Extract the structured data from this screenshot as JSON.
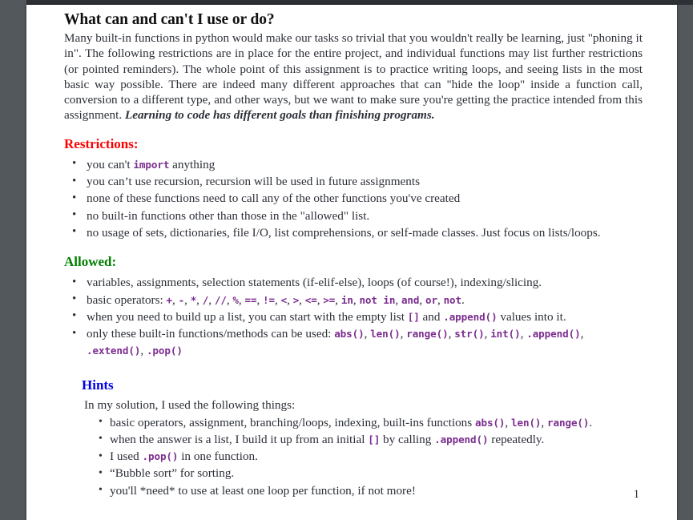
{
  "document": {
    "title": "What can and can't I use or do?",
    "intro_before_emphasis": "Many built-in functions in python would make our tasks so trivial that you wouldn't really be learning, just \"phoning it in\". The following restrictions are in place for the entire project, and individual functions may list further restrictions (or pointed reminders). The whole point of this assignment is to practice writing loops, and seeing lists in the most basic way possible. There are indeed many different approaches that can \"hide the loop\" inside a function call, conversion to a different type, and other ways, but we want to make sure you're getting the practice intended from this assignment. ",
    "intro_emphasis": "Learning to code has different goals than finishing programs.",
    "page_number": "1"
  },
  "restrictions": {
    "heading": "Restrictions:",
    "heading_color": "#ff0000",
    "items": [
      {
        "parts": [
          {
            "text": "you can't ",
            "style": "normal"
          },
          {
            "text": "import",
            "style": "code"
          },
          {
            "text": " anything",
            "style": "normal"
          }
        ]
      },
      {
        "parts": [
          {
            "text": "you can’t use recursion, recursion will be used in future assignments",
            "style": "normal"
          }
        ]
      },
      {
        "parts": [
          {
            "text": "none of these functions need to call any of the other functions you've created",
            "style": "normal"
          }
        ]
      },
      {
        "parts": [
          {
            "text": "no built-in functions other than those in the \"allowed\" list.",
            "style": "normal"
          }
        ]
      },
      {
        "parts": [
          {
            "text": "no usage of sets, dictionaries, file I/O, list comprehensions, or self-made classes. Just focus on lists/loops.",
            "style": "normal"
          }
        ]
      }
    ]
  },
  "allowed": {
    "heading": "Allowed:",
    "heading_color": "#008000",
    "items": [
      {
        "parts": [
          {
            "text": "variables, assignments, selection statements (if-elif-else), loops (of course!), indexing/slicing.",
            "style": "normal"
          }
        ]
      },
      {
        "parts": [
          {
            "text": "basic operators: ",
            "style": "normal"
          },
          {
            "text": "+",
            "style": "code"
          },
          {
            "text": ", ",
            "style": "normal"
          },
          {
            "text": "-",
            "style": "code"
          },
          {
            "text": ", ",
            "style": "normal"
          },
          {
            "text": "*",
            "style": "code"
          },
          {
            "text": ", ",
            "style": "normal"
          },
          {
            "text": "/",
            "style": "code"
          },
          {
            "text": ", ",
            "style": "normal"
          },
          {
            "text": "//",
            "style": "code"
          },
          {
            "text": ", ",
            "style": "normal"
          },
          {
            "text": "%",
            "style": "code"
          },
          {
            "text": ", ",
            "style": "normal"
          },
          {
            "text": "==",
            "style": "code"
          },
          {
            "text": ", ",
            "style": "normal"
          },
          {
            "text": "!=",
            "style": "code"
          },
          {
            "text": ", ",
            "style": "normal"
          },
          {
            "text": "<",
            "style": "code"
          },
          {
            "text": ", ",
            "style": "normal"
          },
          {
            "text": ">",
            "style": "code"
          },
          {
            "text": ", ",
            "style": "normal"
          },
          {
            "text": "<=",
            "style": "code"
          },
          {
            "text": ", ",
            "style": "normal"
          },
          {
            "text": ">=",
            "style": "code"
          },
          {
            "text": ", ",
            "style": "normal"
          },
          {
            "text": "in",
            "style": "code"
          },
          {
            "text": ", ",
            "style": "normal"
          },
          {
            "text": "not  in",
            "style": "code"
          },
          {
            "text": ", ",
            "style": "normal"
          },
          {
            "text": "and",
            "style": "code"
          },
          {
            "text": ", ",
            "style": "normal"
          },
          {
            "text": "or",
            "style": "code"
          },
          {
            "text": ", ",
            "style": "normal"
          },
          {
            "text": "not",
            "style": "code"
          },
          {
            "text": ".",
            "style": "normal"
          }
        ]
      },
      {
        "parts": [
          {
            "text": "when you need to build up a list, you can start with the empty list ",
            "style": "normal"
          },
          {
            "text": "[]",
            "style": "code"
          },
          {
            "text": " and ",
            "style": "normal"
          },
          {
            "text": ".append()",
            "style": "code"
          },
          {
            "text": " values into it.",
            "style": "normal"
          }
        ]
      },
      {
        "parts": [
          {
            "text": "only these built-in functions/methods can be used: ",
            "style": "normal"
          },
          {
            "text": "abs()",
            "style": "code"
          },
          {
            "text": ", ",
            "style": "normal"
          },
          {
            "text": "len()",
            "style": "code"
          },
          {
            "text": ", ",
            "style": "normal"
          },
          {
            "text": "range()",
            "style": "code"
          },
          {
            "text": ", ",
            "style": "normal"
          },
          {
            "text": "str()",
            "style": "code"
          },
          {
            "text": ", ",
            "style": "normal"
          },
          {
            "text": "int()",
            "style": "code"
          },
          {
            "text": ", ",
            "style": "normal"
          },
          {
            "text": ".append()",
            "style": "code"
          },
          {
            "text": ", ",
            "style": "normal"
          },
          {
            "text": ".extend()",
            "style": "code"
          },
          {
            "text": ", ",
            "style": "normal"
          },
          {
            "text": ".pop()",
            "style": "code"
          }
        ]
      }
    ]
  },
  "hints": {
    "heading": "Hints",
    "heading_color": "#0000ee",
    "lead": "In my solution, I used the following things:",
    "items": [
      {
        "parts": [
          {
            "text": "basic operators, assignment, branching/loops, indexing, built-ins functions ",
            "style": "normal"
          },
          {
            "text": "abs()",
            "style": "code"
          },
          {
            "text": ", ",
            "style": "normal"
          },
          {
            "text": "len()",
            "style": "code"
          },
          {
            "text": ", ",
            "style": "normal"
          },
          {
            "text": "range()",
            "style": "code"
          },
          {
            "text": ".",
            "style": "normal"
          }
        ]
      },
      {
        "parts": [
          {
            "text": "when the answer is a list, I build it up from an initial ",
            "style": "normal"
          },
          {
            "text": "[]",
            "style": "code"
          },
          {
            "text": " by calling ",
            "style": "normal"
          },
          {
            "text": ".append()",
            "style": "code"
          },
          {
            "text": " repeatedly.",
            "style": "normal"
          }
        ]
      },
      {
        "parts": [
          {
            "text": "I used ",
            "style": "normal"
          },
          {
            "text": ".pop()",
            "style": "code"
          },
          {
            "text": " in one function.",
            "style": "normal"
          }
        ]
      },
      {
        "parts": [
          {
            "text": "“Bubble sort” for sorting.",
            "style": "normal"
          }
        ]
      },
      {
        "parts": [
          {
            "text": "you'll *need* to use at least one loop per function, if not more!",
            "style": "normal"
          }
        ]
      }
    ]
  }
}
